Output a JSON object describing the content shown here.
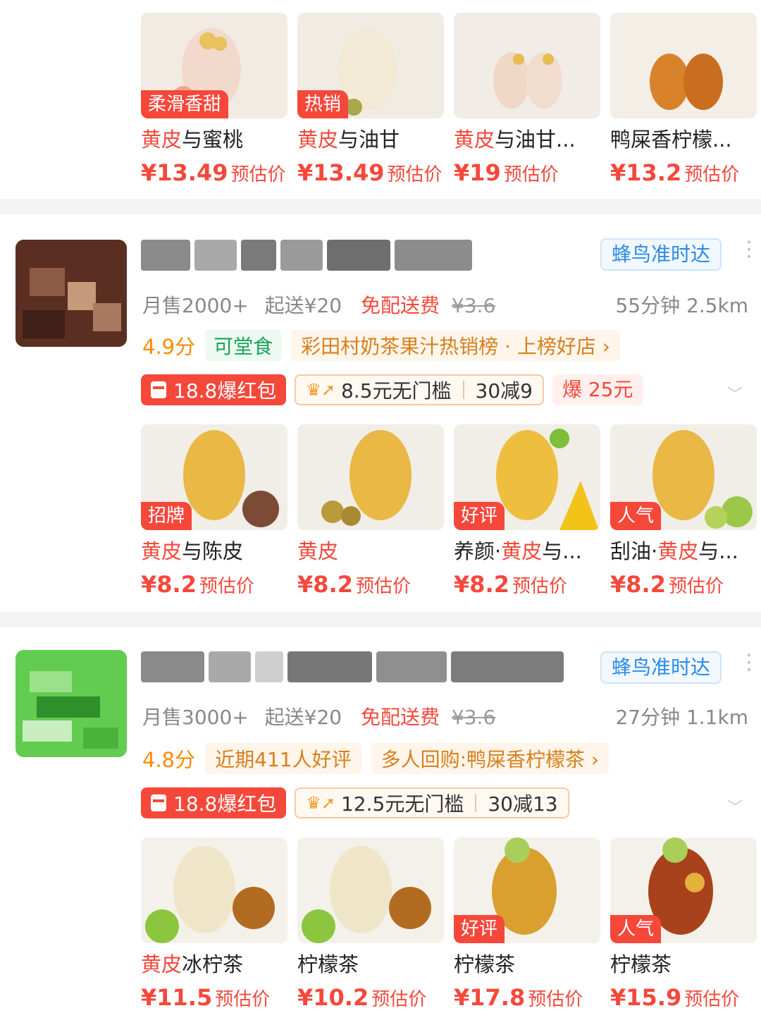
{
  "common": {
    "price_tag": "预估价",
    "delivery_badge": "蜂鸟准时达",
    "free_delivery": "免配送费",
    "more_icon": "⋮",
    "expand_icon": "﹀",
    "colors": {
      "accent_red": "#f5483b",
      "score_orange": "#ff8a00",
      "link_blue": "#2a8be6",
      "green": "#19a35a"
    }
  },
  "top_products": [
    {
      "badge": "柔滑香甜",
      "name_hl": "黄皮",
      "name_rest": "与蜜桃",
      "price": "¥13.49"
    },
    {
      "badge": "热销",
      "name_hl": "黄皮",
      "name_rest": "与油甘",
      "price": "¥13.49"
    },
    {
      "badge": "",
      "name_hl": "黄皮",
      "name_rest": "与油甘...",
      "price": "¥19"
    },
    {
      "badge": "",
      "name_hl": "",
      "name_rest": "鸭屎香柠檬...",
      "price": "¥13.2"
    }
  ],
  "shops": [
    {
      "monthly_sales": "月售2000+",
      "min_order": "起送¥20",
      "old_fee": "¥3.6",
      "distance": "55分钟 2.5km",
      "score": "4.9分",
      "green_tag": "可堂食",
      "rank_tag": "彩田村奶茶果汁热销榜 · 上榜好店 ›",
      "repeat_tag": "",
      "redpack": "18.8爆红包",
      "coupon_main": "8.5元无门槛",
      "coupon_sub": "30减9",
      "bao": "爆 25元",
      "products": [
        {
          "badge": "招牌",
          "name_pre": "",
          "name_hl": "黄皮",
          "name_rest": "与陈皮",
          "price": "¥8.2"
        },
        {
          "badge": "",
          "name_pre": "",
          "name_hl": "黄皮",
          "name_rest": "",
          "price": "¥8.2"
        },
        {
          "badge": "好评",
          "name_pre": "养颜·",
          "name_hl": "黄皮",
          "name_rest": "与...",
          "price": "¥8.2"
        },
        {
          "badge": "人气",
          "name_pre": "刮油·",
          "name_hl": "黄皮",
          "name_rest": "与...",
          "price": "¥8.2"
        }
      ]
    },
    {
      "monthly_sales": "月售3000+",
      "min_order": "起送¥20",
      "old_fee": "¥3.6",
      "distance": "27分钟 1.1km",
      "score": "4.8分",
      "green_tag": "",
      "rank_tag": "近期411人好评",
      "repeat_tag": "多人回购:鸭屎香柠檬茶 ›",
      "redpack": "18.8爆红包",
      "coupon_main": "12.5元无门槛",
      "coupon_sub": "30减13",
      "bao": "",
      "products": [
        {
          "badge": "",
          "name_pre": "",
          "name_hl": "黄皮",
          "name_rest": "冰柠茶",
          "price": "¥11.5"
        },
        {
          "badge": "",
          "name_pre": "",
          "name_hl": "",
          "name_rest": "柠檬茶",
          "price": "¥10.2"
        },
        {
          "badge": "好评",
          "name_pre": "",
          "name_hl": "",
          "name_rest": "柠檬茶",
          "price": "¥17.8"
        },
        {
          "badge": "人气",
          "name_pre": "",
          "name_hl": "",
          "name_rest": "柠檬茶",
          "price": "¥15.9"
        }
      ]
    }
  ]
}
